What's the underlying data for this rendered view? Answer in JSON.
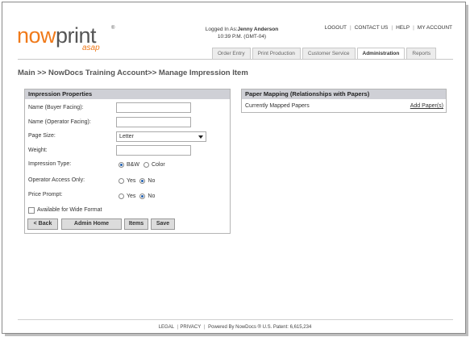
{
  "logo": {
    "now": "now",
    "print": "print",
    "tm": "®",
    "asap": "asap"
  },
  "user": {
    "prefix": "Logged In As:",
    "name": "Jenny Anderson",
    "time": "10:39 P.M. (GMT-04)"
  },
  "toplinks": [
    "LOGOUT",
    "CONTACT US",
    "HELP",
    "MY ACCOUNT"
  ],
  "tabs": [
    {
      "label": "Order Entry",
      "active": false
    },
    {
      "label": "Print Production",
      "active": false
    },
    {
      "label": "Customer Service",
      "active": false
    },
    {
      "label": "Administration",
      "active": true
    },
    {
      "label": "Reports",
      "active": false
    }
  ],
  "breadcrumb": "Main >> NowDocs Training Account>> Manage Impression Item",
  "impression": {
    "title": "Impression Properties",
    "name_buyer_label": "Name (Buyer Facing):",
    "name_buyer_value": "",
    "name_operator_label": "Name (Operator Facing):",
    "name_operator_value": "",
    "page_size_label": "Page Size:",
    "page_size_value": "Letter",
    "weight_label": "Weight:",
    "weight_value": "",
    "impression_type_label": "Impression Type:",
    "impression_type_options": [
      "B&W",
      "Color"
    ],
    "impression_type_selected": "B&W",
    "operator_access_label": "Operator Access Only:",
    "operator_access_options": [
      "Yes",
      "No"
    ],
    "operator_access_selected": "No",
    "price_prompt_label": "Price Prompt:",
    "price_prompt_options": [
      "Yes",
      "No"
    ],
    "price_prompt_selected": "No",
    "wide_format_label": "Available for Wide Format",
    "wide_format_checked": false,
    "buttons": {
      "back": "< Back",
      "admin_home": "Admin Home",
      "items": "Items",
      "save": "Save"
    }
  },
  "paper_mapping": {
    "title": "Paper Mapping (Relationships with Papers)",
    "current_label": "Currently Mapped Papers",
    "add_label": "Add Paper(s)"
  },
  "footer": {
    "legal": "LEGAL",
    "privacy": "PRIVACY",
    "powered": "Powered By NowDocs ® U.S. Patent: 6,615,234"
  }
}
